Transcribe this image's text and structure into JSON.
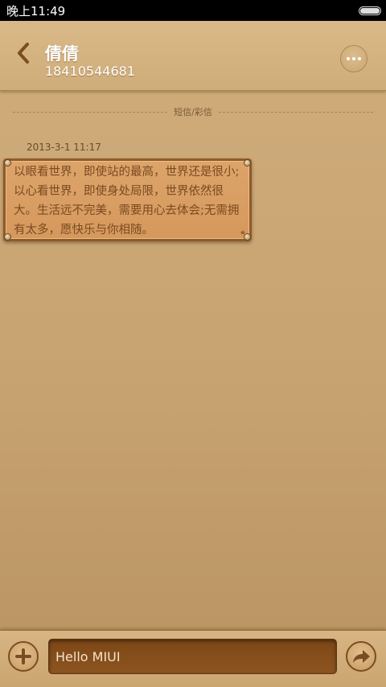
{
  "status_bar": {
    "time": "晚上11:49"
  },
  "header": {
    "contact_name": "倩倩",
    "contact_number": "18410544681"
  },
  "conversation": {
    "divider_label": "短信/彩信",
    "messages": [
      {
        "timestamp": "2013-3-1 11:17",
        "text": "以眼看世界，即使站的最高，世界还是很小;以心看世界，即使身处局限，世界依然很大。生活远不完美，需要用心去体会;无需拥有太多，愿快乐与你相随。"
      }
    ]
  },
  "compose": {
    "placeholder": "Hello MIUI"
  },
  "colors": {
    "background": "#c7a371",
    "bubble": "#d6985c",
    "bubble_border": "#8f5a2a",
    "input_bg": "#7d4716"
  },
  "icons": {
    "back": "chevron-left-icon",
    "more": "more-dots-icon",
    "attach": "plus-icon",
    "send": "send-arrow-icon"
  }
}
